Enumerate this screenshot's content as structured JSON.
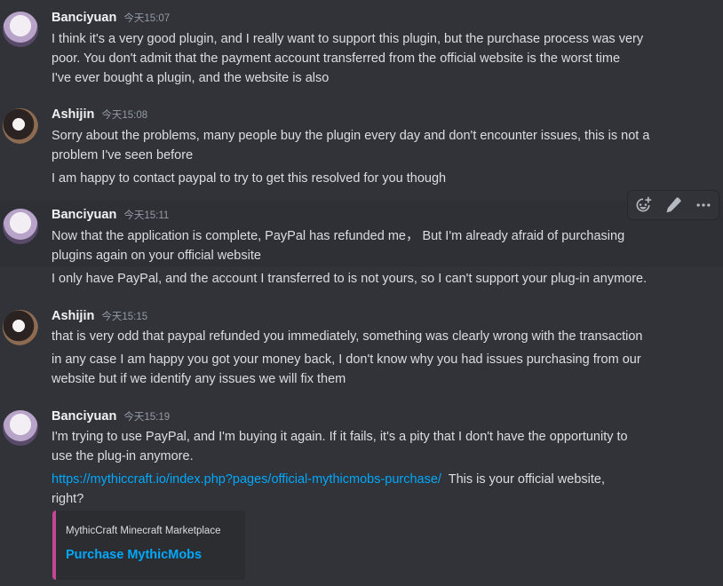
{
  "messages": [
    {
      "username": "Banciyuan",
      "timestamp": "今天15:07",
      "lines": [
        "I think it's a very good plugin, and I really want to support this plugin, but the purchase process was very",
        "poor. You don't admit that the payment account transferred from the official website is the worst time",
        "I've ever bought a plugin, and the website is also"
      ]
    },
    {
      "username": "Ashijin",
      "timestamp": "今天15:08",
      "lines": [
        "Sorry about the problems, many people buy the plugin every day and don't encounter issues, this is not a",
        "problem I've seen before",
        "I am happy to contact paypal to try to get this resolved for you though"
      ]
    },
    {
      "username": "Banciyuan",
      "timestamp": "今天15:11",
      "lines": [
        "Now that the application is complete, PayPal has refunded me， But I'm already afraid of purchasing",
        "plugins again on your official website",
        "I only have PayPal, and the account I transferred to is not yours, so I can't support your plug-in anymore."
      ]
    },
    {
      "username": "Ashijin",
      "timestamp": "今天15:15",
      "lines": [
        "that is very odd that paypal refunded you immediately, something was clearly wrong with the transaction",
        "in any case I am happy you got your money back, I don't know why you had issues purchasing from our",
        "website but if we identify any issues we will fix them"
      ]
    },
    {
      "username": "Banciyuan",
      "timestamp": "今天15:19",
      "lines": [
        "I'm trying to use PayPal, and I'm buying it again. If it fails, it's a pity that I don't have the opportunity to",
        "use the plug-in anymore.",
        "right?"
      ],
      "link": "https://mythiccraft.io/index.php?pages/official-mythicmobs-purchase/",
      "link_suffix": "  This is your official website,"
    }
  ],
  "embed": {
    "provider": "MythicCraft Minecraft Marketplace",
    "title": "Purchase MythicMobs"
  },
  "toolbar": {
    "icons": [
      "add-reaction-icon",
      "edit-icon",
      "more-icon"
    ]
  },
  "colors": {
    "background": "#313338",
    "link": "#00a8fc",
    "embed_border": "#c34593"
  }
}
